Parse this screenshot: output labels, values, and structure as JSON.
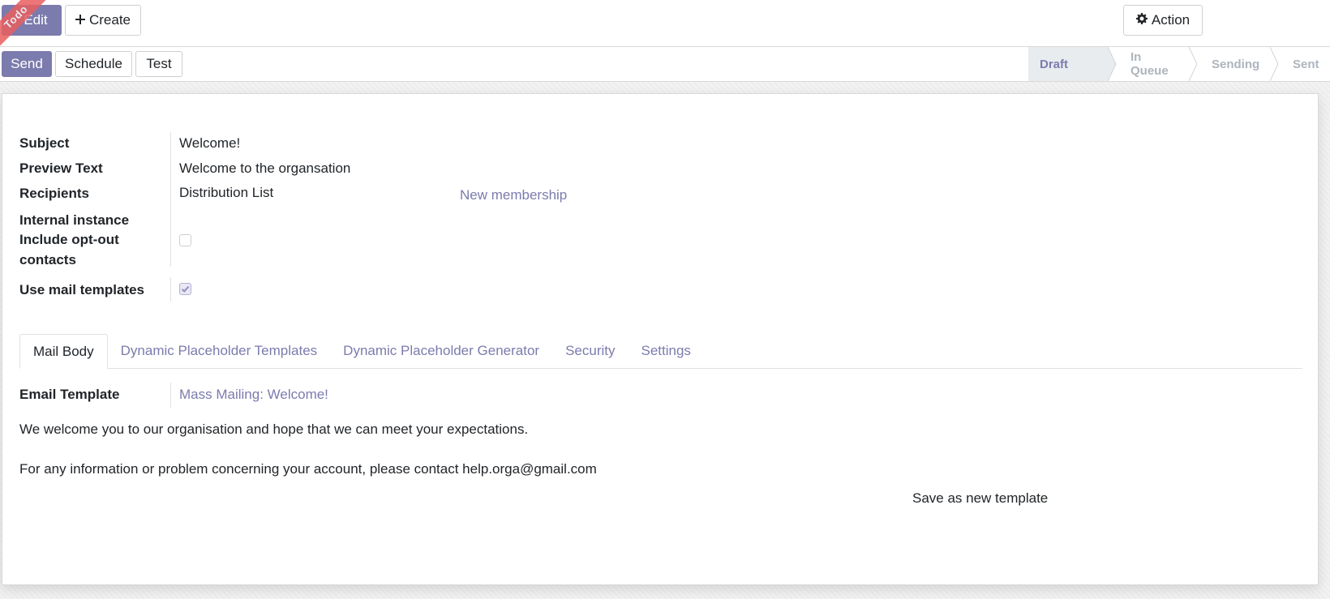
{
  "ribbon": {
    "text": "Todo"
  },
  "control_panel": {
    "edit_label": "Edit",
    "create_label": "Create",
    "action_label": "Action"
  },
  "header_buttons": {
    "send_label": "Send",
    "schedule_label": "Schedule",
    "test_label": "Test"
  },
  "statusbar": {
    "stages": [
      "Draft",
      "In Queue",
      "Sending",
      "Sent"
    ],
    "active": "Draft"
  },
  "form": {
    "subject": {
      "label": "Subject",
      "value": "Welcome!"
    },
    "preview_text": {
      "label": "Preview Text",
      "value": "Welcome to the organsation"
    },
    "recipients": {
      "label": "Recipients",
      "value": "Distribution List",
      "link": "New membership"
    },
    "internal_instance": {
      "label": "Internal instance"
    },
    "include_opt_out": {
      "label_line1": "Include opt-out",
      "label_line2": "contacts",
      "checked": false
    },
    "use_mail_templates": {
      "label": "Use mail templates",
      "checked": true
    }
  },
  "tabs": [
    "Mail Body",
    "Dynamic Placeholder Templates",
    "Dynamic Placeholder Generator",
    "Security",
    "Settings"
  ],
  "mail_body": {
    "email_template_label": "Email Template",
    "email_template_value": "Mass Mailing: Welcome!",
    "paragraph1": "We welcome you to our organisation and hope that we can meet your expectations.",
    "paragraph2": "For any information or problem concerning your account, please contact help.orga@gmail.com",
    "save_template_label": "Save as new template"
  },
  "colors": {
    "primary": "#7c7bad",
    "active_stage_bg": "#e9ecef",
    "ribbon": "#e95f5f"
  }
}
